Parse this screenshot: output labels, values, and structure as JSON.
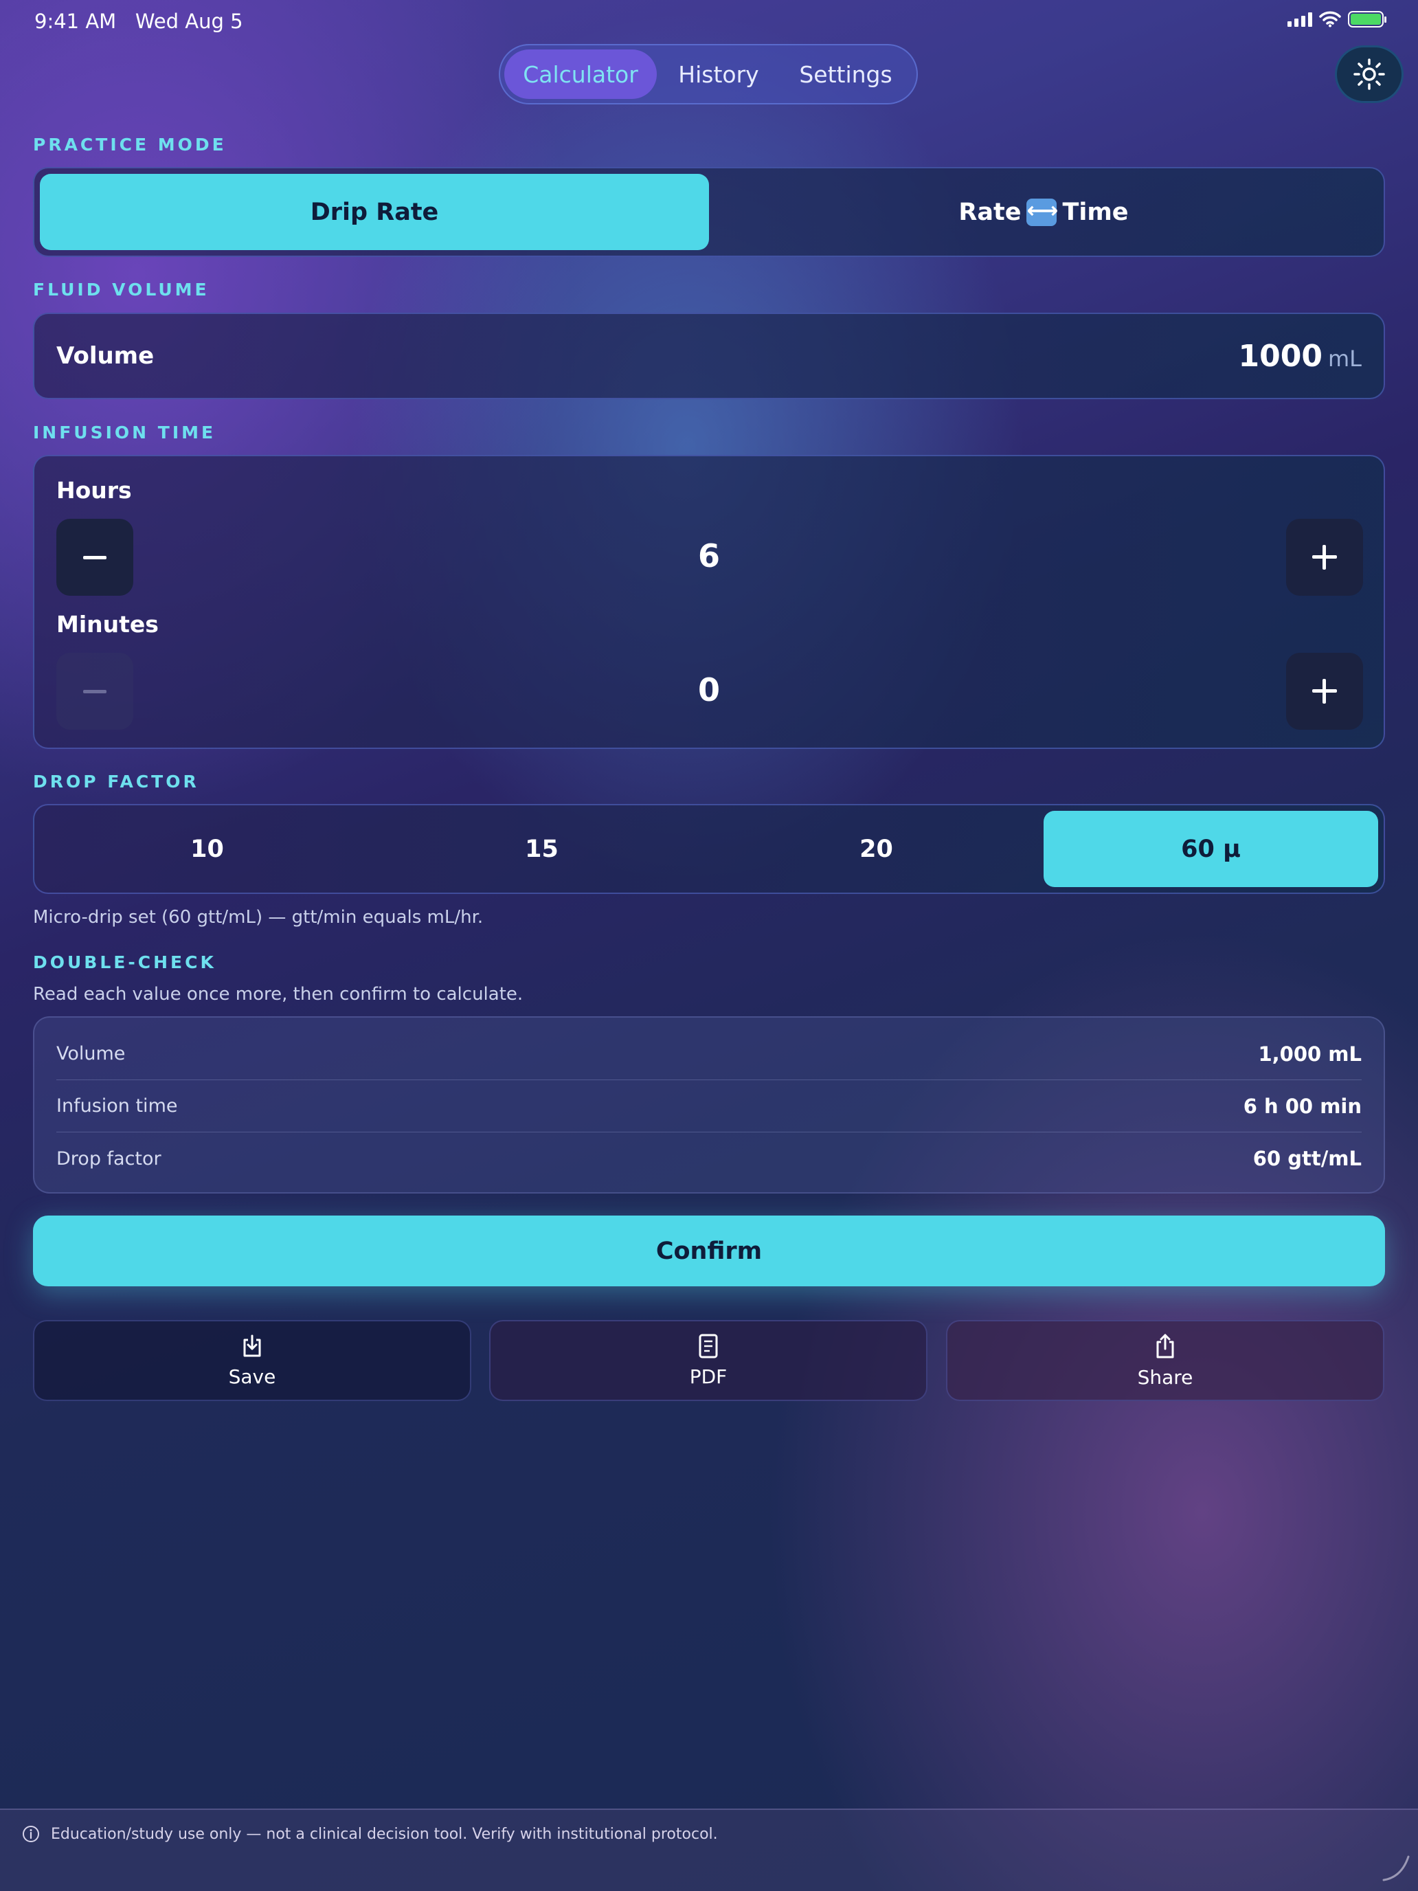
{
  "status_bar": {
    "time": "9:41 AM",
    "date": "Wed Aug 5"
  },
  "nav": {
    "tabs": [
      {
        "label": "Calculator"
      },
      {
        "label": "History"
      },
      {
        "label": "Settings"
      }
    ],
    "active": "Calculator"
  },
  "theme_toggle": {
    "icon": "sun-icon"
  },
  "practice_mode": {
    "label": "PRACTICE MODE",
    "options": [
      {
        "label": "Drip Rate"
      },
      {
        "label_left": "Rate",
        "label_right": "Time"
      }
    ],
    "selected": "Drip Rate"
  },
  "fluid_volume": {
    "label": "FLUID VOLUME",
    "field_label": "Volume",
    "value": "1000",
    "unit": "mL"
  },
  "infusion_time": {
    "label": "INFUSION TIME",
    "hours": {
      "label": "Hours",
      "value": "6"
    },
    "minutes": {
      "label": "Minutes",
      "value": "0"
    }
  },
  "drop_factor": {
    "label": "DROP FACTOR",
    "options": [
      {
        "label": "10"
      },
      {
        "label": "15"
      },
      {
        "label": "20"
      },
      {
        "label": "60 μ"
      }
    ],
    "selected": "60 μ",
    "hint": "Micro-drip set (60 gtt/mL) — gtt/min equals mL/hr."
  },
  "double_check": {
    "label": "DOUBLE-CHECK",
    "instruction": "Read each value once more, then confirm to calculate.",
    "rows": [
      {
        "key": "Volume",
        "value": "1,000 mL"
      },
      {
        "key": "Infusion time",
        "value": "6 h 00 min"
      },
      {
        "key": "Drop factor",
        "value": "60 gtt/mL"
      }
    ]
  },
  "confirm_label": "Confirm",
  "actions": [
    {
      "label": "Save",
      "icon": "download-icon"
    },
    {
      "label": "PDF",
      "icon": "document-icon"
    },
    {
      "label": "Share",
      "icon": "share-icon"
    }
  ],
  "footer": {
    "disclaimer": "Education/study use only — not a clinical decision tool. Verify with institutional protocol."
  },
  "colors": {
    "accent": "#4fd8e8",
    "label": "#6ee0ee",
    "tab_active": "#6b56d8"
  }
}
